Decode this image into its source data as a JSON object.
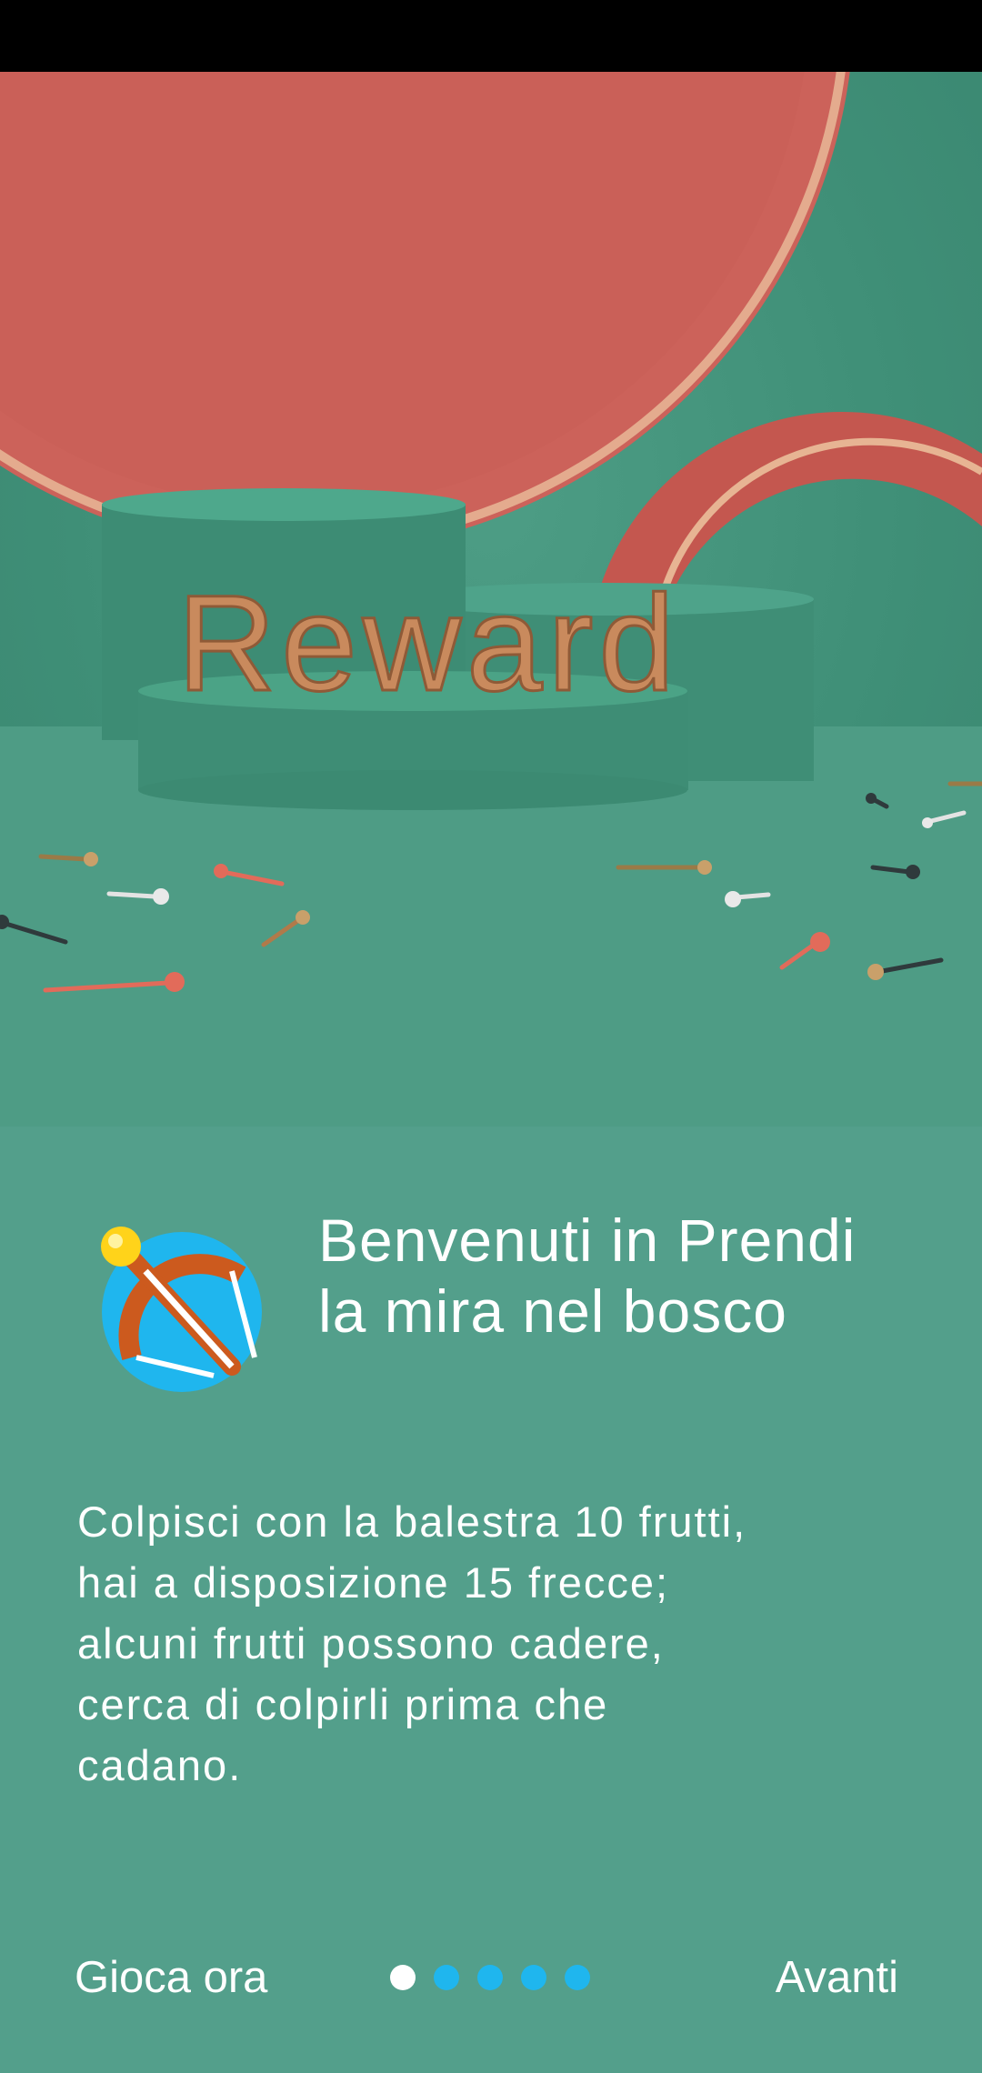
{
  "hero": {
    "banner_text": "Reward"
  },
  "intro": {
    "icon": "crossbow-icon",
    "title": "Benvenuti in Prendi la mira nel bosco",
    "description": "Colpisci con la balestra 10 frutti, hai a disposizione 15 frecce; alcuni frutti possono cadere, cerca di colpirli prima che cadano."
  },
  "footer": {
    "play_now_label": "Gioca ora",
    "next_label": "Avanti",
    "page_indicator": {
      "current": 1,
      "total": 5
    }
  },
  "colors": {
    "background": "#539f8b",
    "accent_dots": "#1fb6ee",
    "active_dot": "#ffffff",
    "hero_coral": "#cc625a"
  }
}
